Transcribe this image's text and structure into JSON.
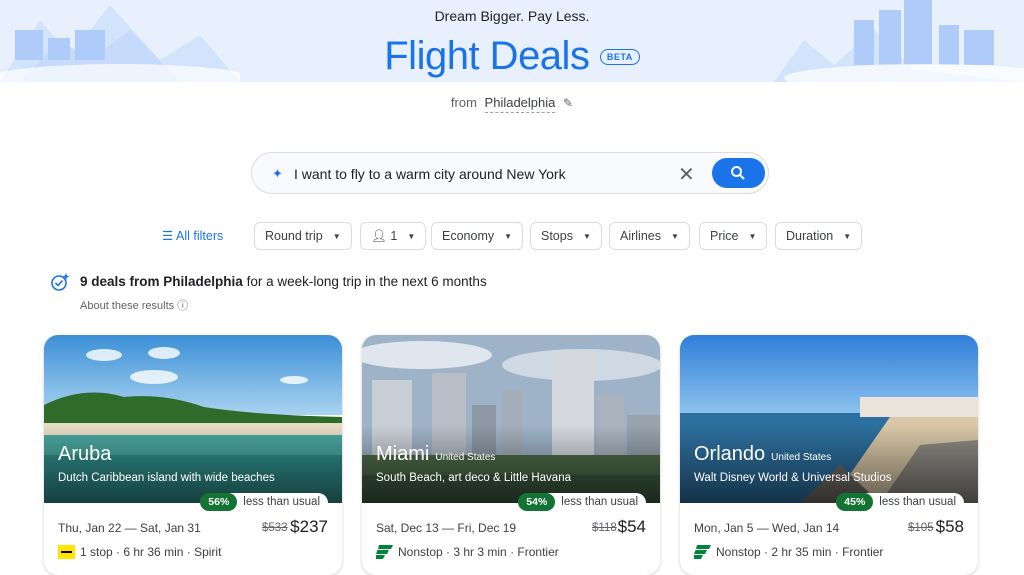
{
  "header": {
    "tagline": "Dream Bigger. Pay Less.",
    "title": "Flight Deals",
    "beta": "BETA",
    "from_label": "from",
    "from_city": "Philadelphia"
  },
  "search": {
    "query": "I want to fly to a warm city around New York"
  },
  "filters": {
    "all_filters": "All filters",
    "trip_type": "Round trip",
    "passengers": "1",
    "cabin": "Economy",
    "stops": "Stops",
    "airlines": "Airlines",
    "price": "Price",
    "duration": "Duration"
  },
  "summary": {
    "count_text": "9 deals from Philadelphia",
    "rest_text": " for a week-long trip in the next 6 months",
    "about": "About these results"
  },
  "colors": {
    "accent": "#1a73e8",
    "deal_green": "#137333",
    "frontier_green": "#00843d",
    "spirit_yellow": "#ffe600"
  },
  "deals": [
    {
      "city": "Aruba",
      "country": "",
      "description": "Dutch Caribbean island with wide beaches",
      "discount_pct": "56%",
      "discount_label": "less than usual",
      "dates": "Thu, Jan 22 — Sat, Jan 31",
      "old_price": "$533",
      "price": "$237",
      "stops": "1 stop",
      "duration": "6 hr 36 min",
      "airline": "Spirit",
      "airline_logo": "spirit-logo"
    },
    {
      "city": "Miami",
      "country": "United States",
      "description": "South Beach, art deco & Little Havana",
      "discount_pct": "54%",
      "discount_label": "less than usual",
      "dates": "Sat, Dec 13 — Fri, Dec 19",
      "old_price": "$118",
      "price": "$54",
      "stops": "Nonstop",
      "duration": "3 hr 3 min",
      "airline": "Frontier",
      "airline_logo": "frontier-logo"
    },
    {
      "city": "Orlando",
      "country": "United States",
      "description": "Walt Disney World & Universal Studios",
      "discount_pct": "45%",
      "discount_label": "less than usual",
      "dates": "Mon, Jan 5 — Wed, Jan 14",
      "old_price": "$105",
      "price": "$58",
      "stops": "Nonstop",
      "duration": "2 hr 35 min",
      "airline": "Frontier",
      "airline_logo": "frontier-logo"
    }
  ]
}
